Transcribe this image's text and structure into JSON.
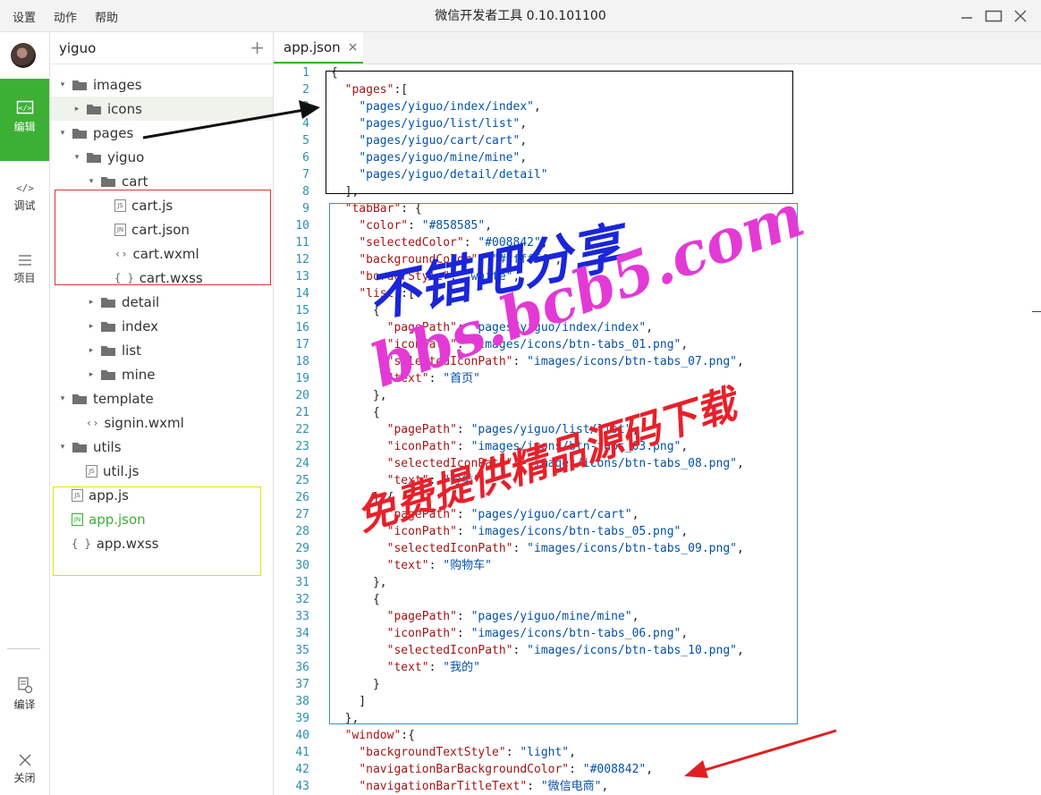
{
  "window": {
    "title": "微信开发者工具 0.10.101100",
    "menu": [
      "设置",
      "动作",
      "帮助"
    ]
  },
  "leftbar": {
    "items": [
      {
        "label": "编辑",
        "icon": "code-square-icon",
        "active": true
      },
      {
        "label": "调试",
        "icon": "code-brackets-icon"
      },
      {
        "label": "项目",
        "icon": "menu-icon"
      },
      {
        "label": "编译",
        "icon": "compile-icon"
      },
      {
        "label": "关闭",
        "icon": "close-icon"
      }
    ]
  },
  "sidebar": {
    "project": "yiguo",
    "add_label": "+",
    "tree": [
      {
        "label": "images",
        "type": "folder",
        "depth": 0,
        "open": true
      },
      {
        "label": "icons",
        "type": "folder",
        "depth": 1,
        "open": false,
        "selected": true
      },
      {
        "label": "pages",
        "type": "folder",
        "depth": 0,
        "open": true
      },
      {
        "label": "yiguo",
        "type": "folder",
        "depth": 1,
        "open": true
      },
      {
        "label": "cart",
        "type": "folder",
        "depth": 2,
        "open": true
      },
      {
        "label": "cart.js",
        "type": "js",
        "depth": 3
      },
      {
        "label": "cart.json",
        "type": "json",
        "depth": 3
      },
      {
        "label": "cart.wxml",
        "type": "wxml",
        "depth": 3
      },
      {
        "label": "cart.wxss",
        "type": "wxss",
        "depth": 3
      },
      {
        "label": "detail",
        "type": "folder",
        "depth": 2,
        "open": false
      },
      {
        "label": "index",
        "type": "folder",
        "depth": 2,
        "open": false
      },
      {
        "label": "list",
        "type": "folder",
        "depth": 2,
        "open": false
      },
      {
        "label": "mine",
        "type": "folder",
        "depth": 2,
        "open": false
      },
      {
        "label": "template",
        "type": "folder",
        "depth": 0,
        "open": true
      },
      {
        "label": "signin.wxml",
        "type": "wxml",
        "depth": 1
      },
      {
        "label": "utils",
        "type": "folder",
        "depth": 0,
        "open": true
      },
      {
        "label": "util.js",
        "type": "js",
        "depth": 1
      },
      {
        "label": "app.js",
        "type": "js",
        "depth": 0
      },
      {
        "label": "app.json",
        "type": "json",
        "depth": 0,
        "active": true
      },
      {
        "label": "app.wxss",
        "type": "wxss",
        "depth": 0
      }
    ]
  },
  "editor": {
    "tab": "app.json",
    "tab_close": "×",
    "lines": [
      "{",
      "  \"pages\":[",
      "    \"pages/yiguo/index/index\",",
      "    \"pages/yiguo/list/list\",",
      "    \"pages/yiguo/cart/cart\",",
      "    \"pages/yiguo/mine/mine\",",
      "    \"pages/yiguo/detail/detail\"",
      "  ],",
      "  \"tabBar\": {",
      "    \"color\": \"#858585\",",
      "    \"selectedColor\": \"#008842\",",
      "    \"backgroundColor\": \"#ffffff\",",
      "    \"borderStyle\": \"white\",",
      "    \"list\":[",
      "      {",
      "        \"pagePath\": \"pages/yiguo/index/index\",",
      "        \"iconPath\": \"images/icons/btn-tabs_01.png\",",
      "        \"selectedIconPath\": \"images/icons/btn-tabs_07.png\",",
      "        \"text\": \"首页\"",
      "      },",
      "      {",
      "        \"pagePath\": \"pages/yiguo/list/list\",",
      "        \"iconPath\": \"images/icons/btn-tabs_03.png\",",
      "        \"selectedIconPath\": \"images/icons/btn-tabs_08.png\",",
      "        \"text\": \"分类\"",
      "      },{",
      "        \"pagePath\": \"pages/yiguo/cart/cart\",",
      "        \"iconPath\": \"images/icons/btn-tabs_05.png\",",
      "        \"selectedIconPath\": \"images/icons/btn-tabs_09.png\",",
      "        \"text\": \"购物车\"",
      "      },",
      "      {",
      "        \"pagePath\": \"pages/yiguo/mine/mine\",",
      "        \"iconPath\": \"images/icons/btn-tabs_06.png\",",
      "        \"selectedIconPath\": \"images/icons/btn-tabs_10.png\",",
      "        \"text\": \"我的\"",
      "      }",
      "    ]",
      "  },",
      "  \"window\":{",
      "    \"backgroundTextStyle\": \"light\",",
      "    \"navigationBarBackgroundColor\": \"#008842\",",
      "    \"navigationBarTitleText\": \"微信电商\","
    ]
  },
  "watermark": {
    "line1": "不错吧分享",
    "line2": "bbs.bcb5.com",
    "line3": "免费提供精品源码下载"
  },
  "colors": {
    "accent": "#3cb034",
    "line_number": "#2b91af",
    "json_key": "#a31515",
    "json_string": "#0451a5"
  }
}
